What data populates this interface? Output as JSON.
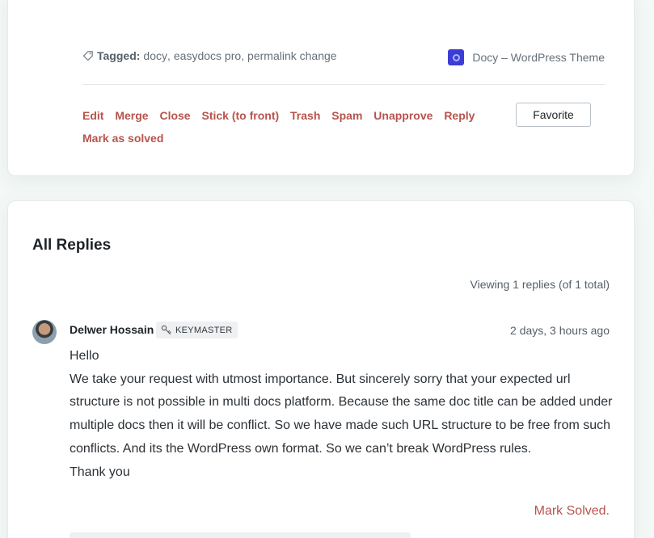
{
  "topic": {
    "tagged_label": "Tagged:",
    "tags": [
      "docy",
      "easydocs pro",
      "permalink change"
    ],
    "forum_link": "Docy – WordPress Theme",
    "admin_links": [
      "Edit",
      "Merge",
      "Close",
      "Stick (to front)",
      "Trash",
      "Spam",
      "Unapprove",
      "Reply",
      "Mark as solved"
    ],
    "favorite_label": "Favorite"
  },
  "replies": {
    "title": "All Replies",
    "viewing_text": "Viewing 1 replies (of 1 total)",
    "items": [
      {
        "author": "Delwer Hossain",
        "role": "KEYMASTER",
        "timestamp": "2 days, 3 hours ago",
        "body": [
          "Hello",
          "We take your request with utmost importance. But sincerely sorry that your expected url structure is not possible in multi docs platform. Because the same doc title can be added under multiple docs then it will be conflict. So we have made such URL structure to be free from such conflicts. And its the WordPress own format. So we can’t break WordPress rules.",
          "Thank you"
        ],
        "mark_solved_label": "Mark Solved."
      }
    ]
  },
  "colors": {
    "accent": "#b8534c",
    "forum_logo": "#3d3dd6",
    "page_background": "#f4f8f6"
  },
  "icons": {
    "tag": "tag-icon",
    "forum": "docy-logo-icon",
    "role": "key-icon"
  }
}
